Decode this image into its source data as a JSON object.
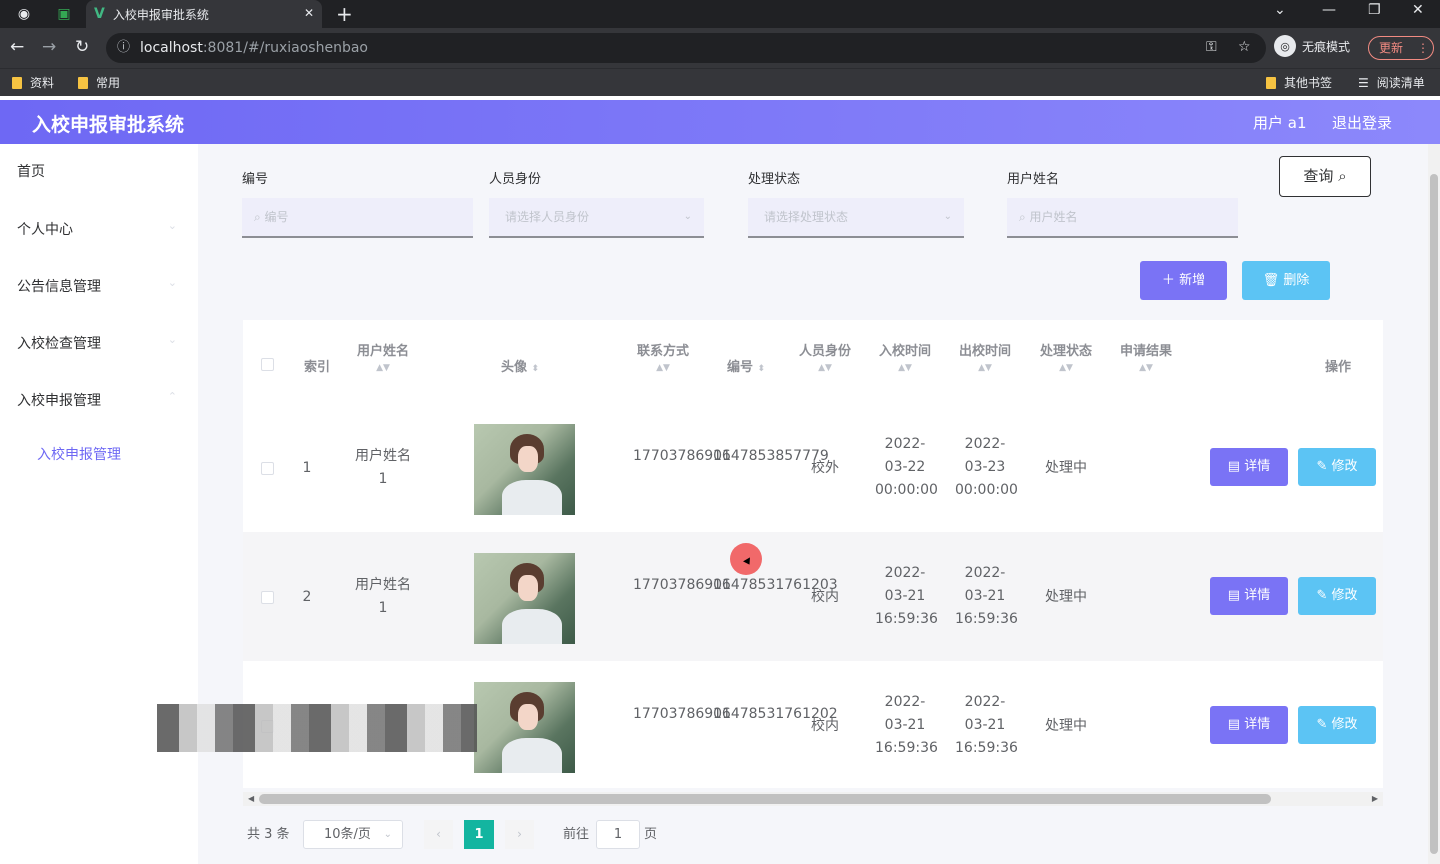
{
  "browser": {
    "tab_title": "入校申报审批系统",
    "url_host": "localhost",
    "url_rest": ":8081/#/ruxiaoshenbao",
    "incognito_label": "无痕模式",
    "update_label": "更新",
    "bookmarks": [
      "资料",
      "常用"
    ],
    "bookmarks_right": [
      "其他书签",
      "阅读清单"
    ]
  },
  "header": {
    "title": "入校申报审批系统",
    "user": "用户 a1",
    "logout": "退出登录"
  },
  "sidebar": {
    "items": [
      {
        "label": "首页"
      },
      {
        "label": "个人中心"
      },
      {
        "label": "公告信息管理"
      },
      {
        "label": "入校检查管理"
      },
      {
        "label": "入校申报管理"
      }
    ],
    "active_sub": "入校申报管理"
  },
  "filters": {
    "f1_label": "编号",
    "f1_placeholder": "编号",
    "f2_label": "人员身份",
    "f2_placeholder": "请选择人员身份",
    "f3_label": "处理状态",
    "f3_placeholder": "请选择处理状态",
    "f4_label": "用户姓名",
    "f4_placeholder": "用户姓名",
    "query_button": "查询"
  },
  "actions": {
    "add": "新增",
    "delete": "删除"
  },
  "table": {
    "headers": {
      "index": "索引",
      "username": "用户姓名",
      "avatar": "头像",
      "contact": "联系方式",
      "code": "编号",
      "identity": "人员身份",
      "in_time": "入校时间",
      "out_time": "出校时间",
      "status": "处理状态",
      "result": "申请结果",
      "ops": "操作"
    },
    "rows": [
      {
        "index": "1",
        "username": "用户姓名1",
        "contact": "17703786901",
        "code": "1647853857779",
        "identity": "校外",
        "in_time": "2022-03-22 00:00:00",
        "out_time": "2022-03-23 00:00:00",
        "status": "处理中",
        "result": ""
      },
      {
        "index": "2",
        "username": "用户姓名1",
        "contact": "17703786901",
        "code": "16478531761203",
        "identity": "校内",
        "in_time": "2022-03-21 16:59:36",
        "out_time": "2022-03-21 16:59:36",
        "status": "处理中",
        "result": ""
      },
      {
        "index": "",
        "username": "",
        "contact": "17703786901",
        "code": "16478531761202",
        "identity": "校内",
        "in_time": "2022-03-21 16:59:36",
        "out_time": "2022-03-21 16:59:36",
        "status": "处理中",
        "result": ""
      }
    ],
    "detail_label": "详情",
    "edit_label": "修改"
  },
  "pagination": {
    "total": "共 3 条",
    "page_size": "10条/页",
    "current": "1",
    "goto_prefix": "前往",
    "goto_value": "1",
    "goto_suffix": "页"
  }
}
